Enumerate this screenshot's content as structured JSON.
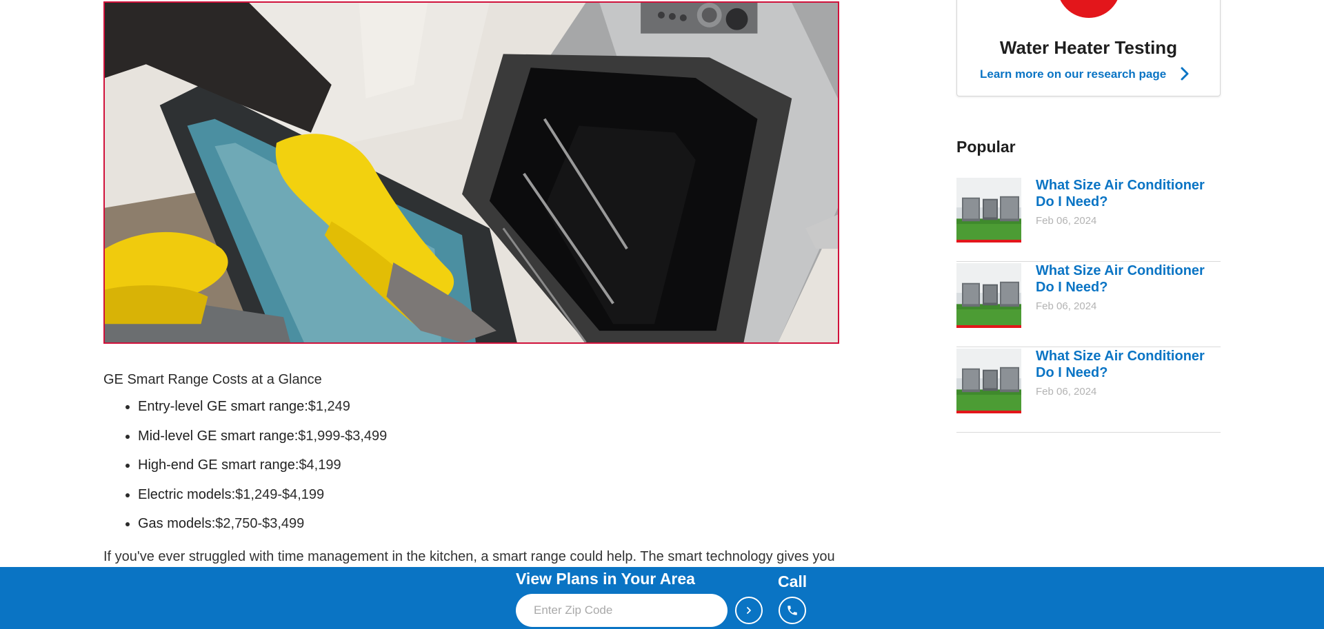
{
  "sidebar": {
    "research_card": {
      "title": "Water Heater Testing",
      "link_text": "Learn more on our research page",
      "accent_color": "#e3161b",
      "arrow_icon": "chevron-right-icon"
    },
    "popular": {
      "heading": "Popular",
      "items": [
        {
          "title": "What Size Air Conditioner Do I Need?",
          "date": "Feb 06, 2024"
        },
        {
          "title": "What Size Air Conditioner Do I Need?",
          "date": "Feb 06, 2024"
        },
        {
          "title": "What Size Air Conditioner Do I Need?",
          "date": "Feb 06, 2024"
        }
      ]
    }
  },
  "article": {
    "hero_image": "person in yellow gloves cleaning open oven door",
    "glance_title": "GE Smart Range Costs at a Glance",
    "cost_items": [
      {
        "label": "Entry-level GE smart range:",
        "value": "$1,249"
      },
      {
        "label": "Mid-level GE smart range:",
        "value": "$1,999-$3,499"
      },
      {
        "label": "High-end GE smart range:",
        "value": "$4,199"
      },
      {
        "label": "Electric models:",
        "value": "$1,249-$4,199"
      },
      {
        "label": "Gas models:",
        "value": "$2,750-$3,499"
      }
    ],
    "intro_text": "If you've ever struggled with time management in the kitchen, a smart range could help. The smart technology gives you"
  },
  "bottom_bar": {
    "plans_title": "View Plans in Your Area",
    "zip_placeholder": "Enter Zip Code",
    "zip_value": "",
    "go_icon": "chevron-right-icon",
    "call_label": "Call",
    "call_icon": "phone-icon",
    "background_color": "#0a74c4"
  },
  "colors": {
    "link_blue": "#0a74c4",
    "accent_red": "#e3161b",
    "hero_border": "#d0103a"
  }
}
